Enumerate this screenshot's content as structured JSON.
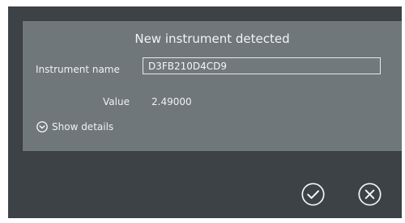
{
  "dialog": {
    "title": "New instrument detected",
    "instrument_name_label": "Instrument name",
    "instrument_name_value": "D3FB210D4CD9",
    "value_label": "Value",
    "value": "2.49000",
    "show_details_label": "Show details"
  },
  "actions": {
    "confirm_icon": "check-circle-icon",
    "close_icon": "close-circle-icon"
  },
  "colors": {
    "background": "#3c4245",
    "dialog_panel": "#6f777a",
    "text": "#f0f2f2",
    "icon": "#f4f5f5"
  }
}
